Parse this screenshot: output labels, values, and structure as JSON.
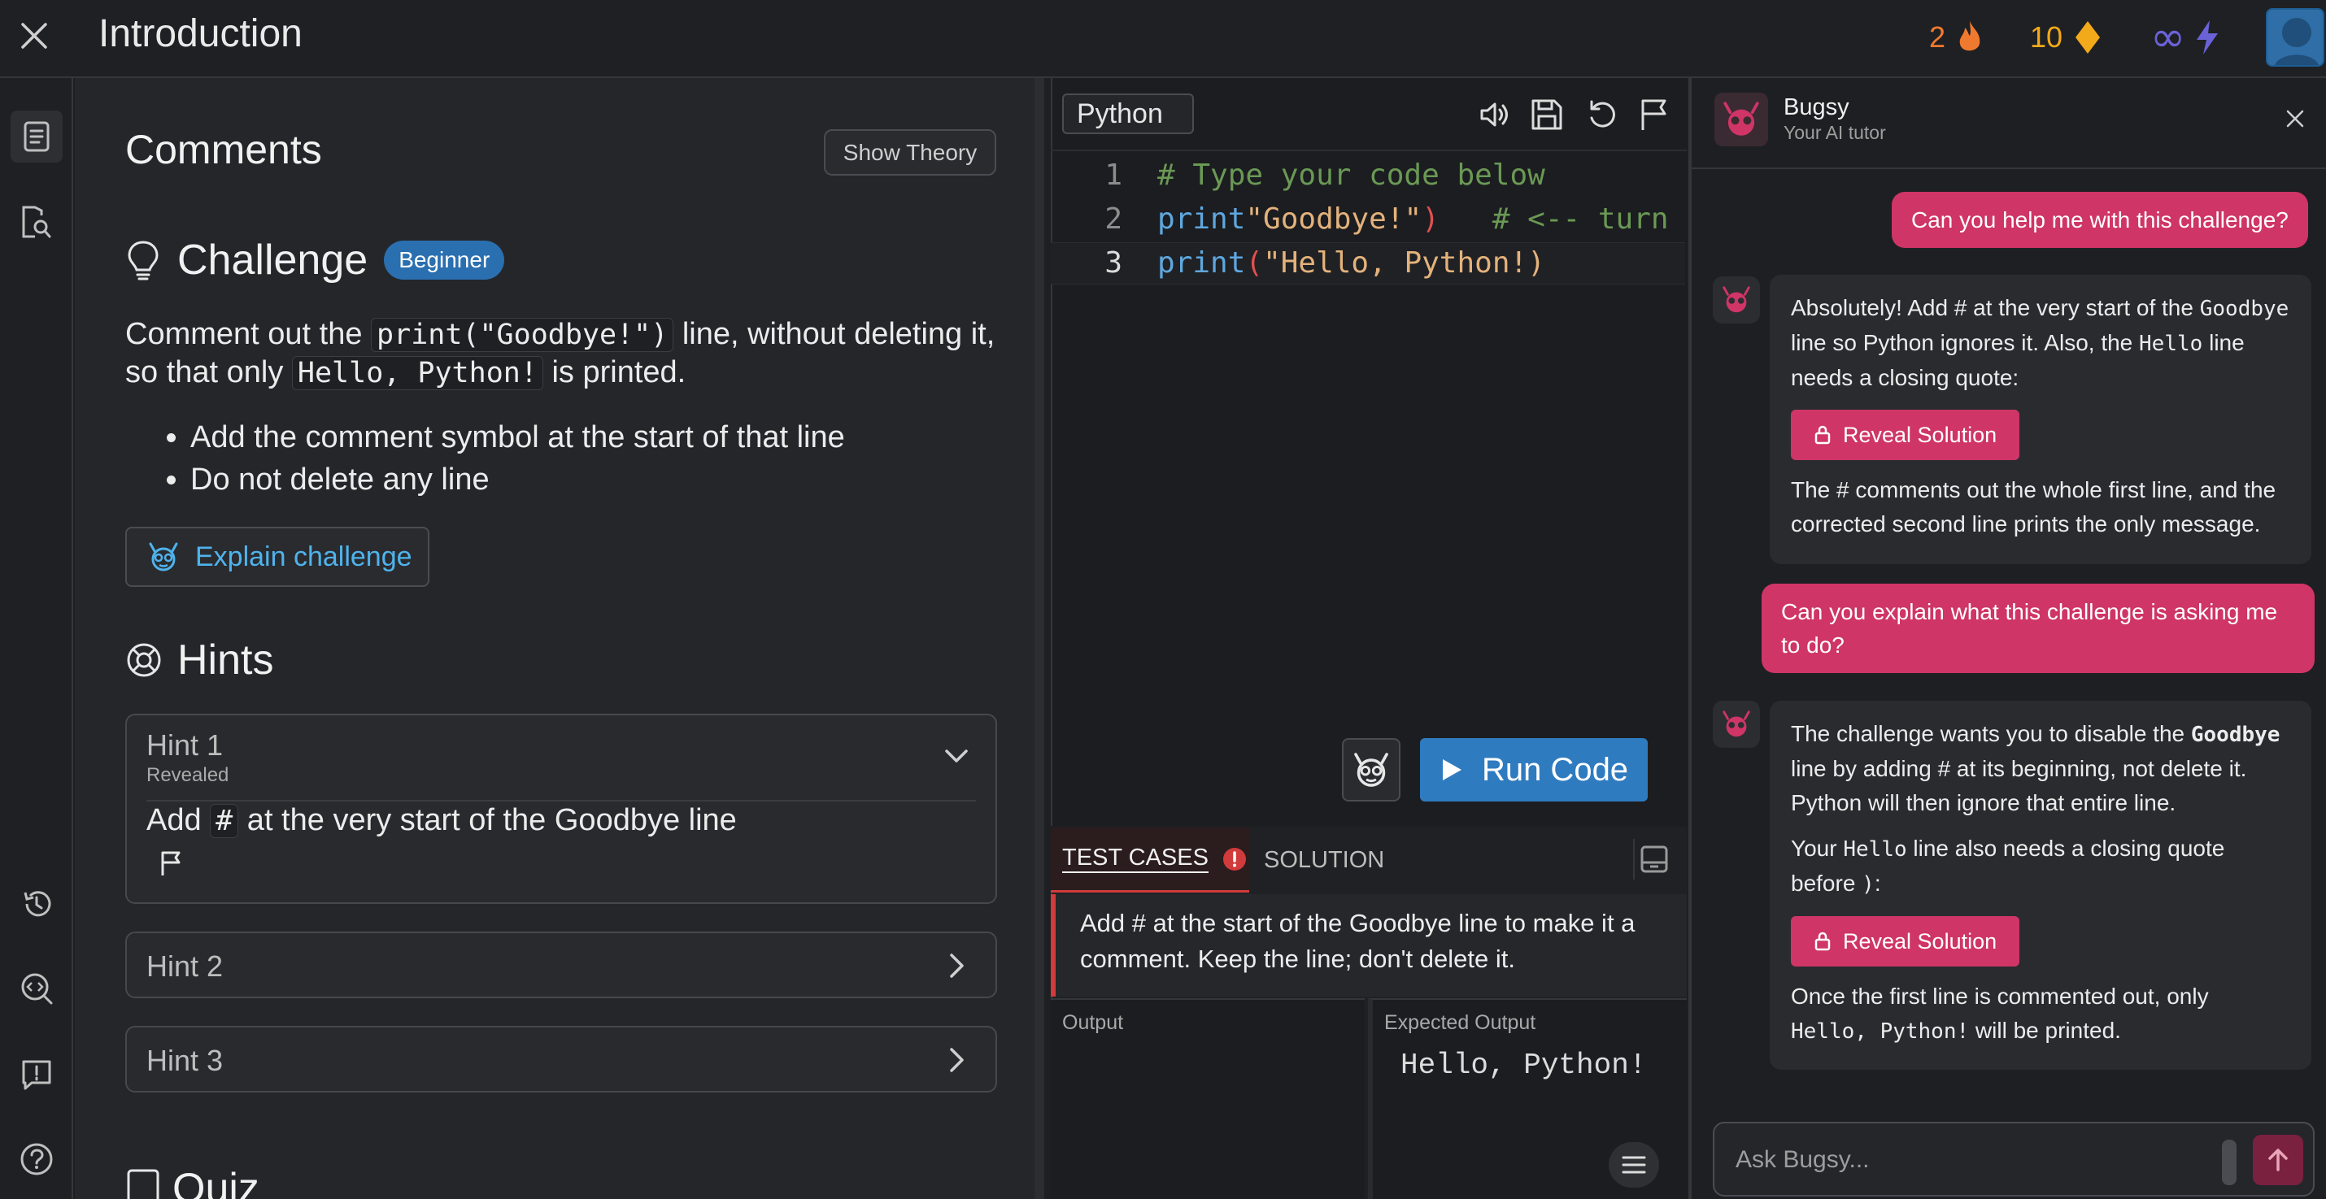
{
  "header": {
    "title": "Introduction",
    "streak": "2",
    "gems": "10",
    "energy": "∞"
  },
  "theory": {
    "lesson_name": "Comments",
    "show_theory_label": "Show Theory",
    "challenge_title": "Challenge",
    "level_badge": "Beginner",
    "desc_1": "Comment out the ",
    "desc_code1": "print(\"Goodbye!\")",
    "desc_2": " line, without deleting it, so that only ",
    "desc_code2": "Hello, Python!",
    "desc_3": " is printed.",
    "requirements": [
      "Add the comment symbol at the start of that line",
      "Do not delete any line"
    ],
    "explain_label": "Explain challenge",
    "hints_title": "Hints",
    "hint1_label": "Hint 1",
    "hint1_status": "Revealed",
    "hint1_pre": "Add ",
    "hint1_code": "#",
    "hint1_post": " at the very start of the Goodbye line",
    "hint2_label": "Hint 2",
    "hint3_label": "Hint 3",
    "quiz_title": "Quiz"
  },
  "editor": {
    "language": "Python",
    "line_numbers": [
      "1",
      "2",
      "3"
    ],
    "line1": "# Type your code below",
    "line2_fn": "print",
    "line2_str": "\"Goodbye!\"",
    "line2_paren": ")",
    "line2_comment": "   # <-- turn",
    "line3_fn": "print",
    "line3_paren": "(",
    "line3_str": "\"Hello, Python!)",
    "run_label": "Run Code"
  },
  "tests": {
    "tab_tests": "TEST CASES",
    "tab_solution": "SOLUTION",
    "message": "Add # at the start of the Goodbye line to make it a comment. Keep the line; don't delete it.",
    "output_label": "Output",
    "expected_label": "Expected Output",
    "expected_value": "Hello, Python!"
  },
  "chat": {
    "name": "Bugsy",
    "subtitle": "Your AI tutor",
    "user1": "Can you help me with this challenge?",
    "bot1_a": "Absolutely! Add # at the very start of the ",
    "bot1_code1": "Goodbye",
    "bot1_b": " line so Python ignores it. Also, the ",
    "bot1_code2": "Hello",
    "bot1_c": " line needs a closing quote:",
    "reveal_label": "Reveal Solution",
    "bot1_d": "The # comments out the whole first line, and the corrected second line prints the only message.",
    "user2": "Can you explain what this challenge is asking me to do?",
    "bot2_a": "The challenge wants you to disable the ",
    "bot2_code1": "Goodbye",
    "bot2_b": " line by adding # at its beginning, not delete it. Python will then ignore that entire line.",
    "bot2_c": "Your ",
    "bot2_code2": "Hello",
    "bot2_d": " line also needs a closing quote before ",
    "bot2_code3": ")",
    "bot2_e": ":",
    "bot2_f": "Once the first line is commented out, only ",
    "bot2_code4": "Hello, Python!",
    "bot2_g": " will be printed.",
    "input_placeholder": "Ask Bugsy..."
  },
  "colors": {
    "accent_pink": "#cf3567",
    "run_blue": "#2f7bbf",
    "badge_blue": "#2a6fb0",
    "error_red": "#d23b3b",
    "streak_orange": "#ef7a2f",
    "gem_yellow": "#f2a91a",
    "energy_purple": "#6b62d8"
  },
  "icons": {
    "close": "close-icon",
    "streak": "flame-icon",
    "gems": "diamond-icon",
    "energy": "bolt-icon",
    "lesson": "document-icon",
    "search_doc": "document-search-icon",
    "history": "history-icon",
    "code_search": "code-search-icon",
    "feedback": "feedback-icon",
    "help": "help-icon"
  }
}
